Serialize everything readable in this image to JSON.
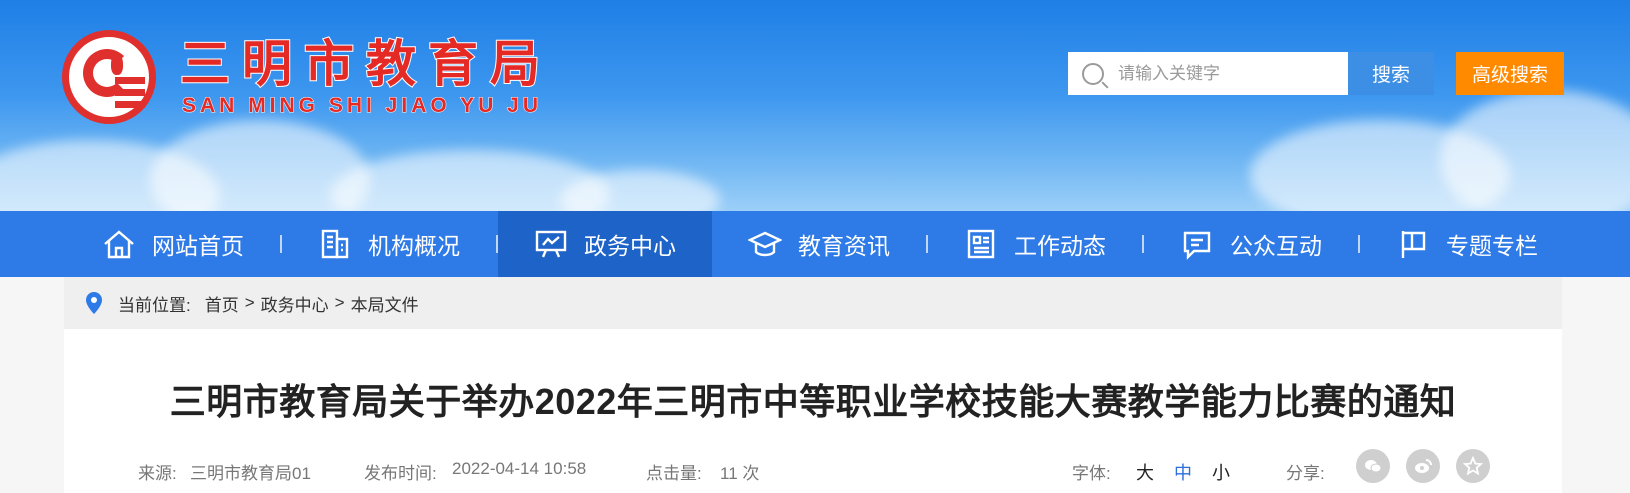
{
  "header": {
    "logo_cn": "三明市教育局",
    "logo_en": "SAN MING SHI JIAO YU JU",
    "search_placeholder": "请输入关键字",
    "search_button": "搜索",
    "advanced_search_button": "高级搜索"
  },
  "nav": {
    "items": [
      {
        "label": "网站首页",
        "icon": "home-icon"
      },
      {
        "label": "机构概况",
        "icon": "building-icon"
      },
      {
        "label": "政务中心",
        "icon": "presentation-icon"
      },
      {
        "label": "教育资讯",
        "icon": "graduation-cap-icon"
      },
      {
        "label": "工作动态",
        "icon": "document-icon"
      },
      {
        "label": "公众互动",
        "icon": "chat-icon"
      },
      {
        "label": "专题专栏",
        "icon": "flag-icon"
      }
    ],
    "active_index": 2
  },
  "breadcrumb": {
    "prefix": "当前位置:",
    "items": [
      "首页",
      ">",
      "政务中心",
      ">",
      "本局文件"
    ]
  },
  "article": {
    "title": "三明市教育局关于举办2022年三明市中等职业学校技能大赛教学能力比赛的通知",
    "source_label": "来源:",
    "source_value": "三明市教育局01",
    "date_label": "发布时间:",
    "date_value": "2022-04-14 10:58",
    "views_label": "点击量:",
    "views_value": "11 次",
    "font_label": "字体:",
    "font_sizes": [
      "大",
      "中",
      "小"
    ],
    "active_font": "中",
    "share_label": "分享:",
    "share_icons": [
      "wechat-icon",
      "weibo-icon",
      "star-icon"
    ]
  },
  "colors": {
    "brand_red": "#e52a26",
    "nav_blue": "#2e7ae6",
    "nav_active": "#1e63c7",
    "accent_orange": "#ff8a00"
  }
}
